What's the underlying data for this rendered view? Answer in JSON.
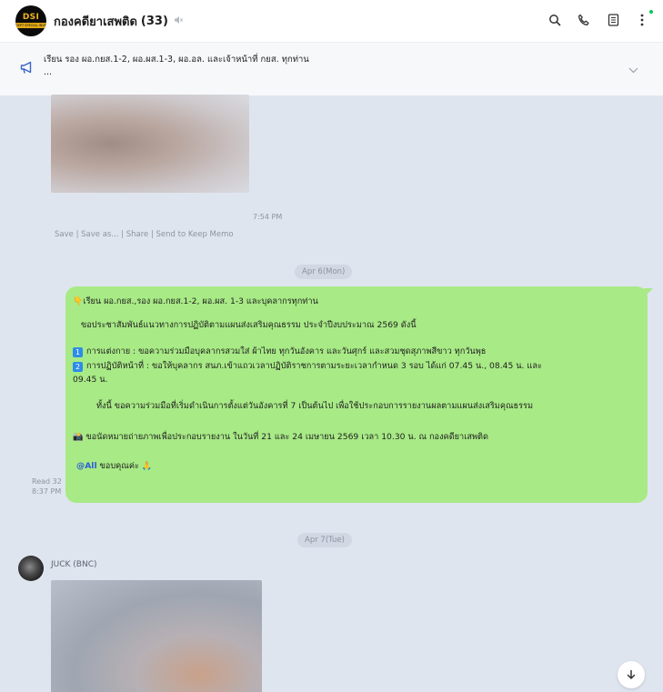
{
  "header": {
    "avatar_logo_text": "DSI",
    "avatar_logo_band": "DEPT SPECIAL INVESTIGATION",
    "title": "กองคดียาเสพติด",
    "member_count": "(33)",
    "icons": [
      "mute-icon",
      "search-icon",
      "phone-icon",
      "notes-icon",
      "more-icon"
    ]
  },
  "announcement": {
    "text": "เรียน รอง ผอ.กยส.1-2, ผอ.ผส.1-3, ผอ.อล. และเจ้าหน้าที่ กยส. ทุกท่าน",
    "more": "...",
    "icon": "megaphone-icon"
  },
  "messages": {
    "image_time": "7:54 PM",
    "image_actions": "Save | Save as... | Share | Send to Keep Memo",
    "date1": "Apr 6(Mon)",
    "bubble": {
      "line1": "👇เรียน ผอ.กยส.,รอง ผอ.กยส.1-2, ผอ.ผส. 1-3 และบุคลากรทุกท่าน",
      "line2": "ขอประชาสัมพันธ์แนวทางการปฏิบัติตามแผนส่งเสริมคุณธรรม ประจำปีงบประมาณ 2569 ดังนี้",
      "item1_num": "1",
      "item1": "การแต่งกาย : ขอความร่วมมือบุคลากรสวมใส่ ผ้าไทย ทุกวันอังคาร และวันศุกร์ และสวมชุดสุภาพสีขาว ทุกวันพุธ",
      "item2_num": "2",
      "item2a": "การปฏิบัติหน้าที่ : ขอให้บุคลากร สนภ.เข้าแถวเวลาปฏิบัติราชการตามระยะเวลากำหนด 3 รอบ ได้แก่ 07.45 น., 08.45 น. และ",
      "item2b": "09.45 น.",
      "line3": "ทั้งนี้ ขอความร่วมมือที่เริ่มดำเนินการตั้งแต่วันอังคารที่ 7 เป็นต้นไป เพื่อใช้ประกอบการรายงานผลตามแผนส่งเสริมคุณธรรม",
      "line4": "📸 ขอนัดหมายถ่ายภาพเพื่อประกอบรายงาน ในวันที่ 21 และ 24 เมษายน 2569 เวลา 10.30 น. ณ กองคดียาเสพติด",
      "mention": "@All",
      "thanks": "ขอบคุณค่ะ 🙏"
    },
    "read_count": "Read 32",
    "bubble_time": "8:37 PM",
    "date2": "Apr 7(Tue)",
    "sender": "JUCK (BNC)"
  }
}
